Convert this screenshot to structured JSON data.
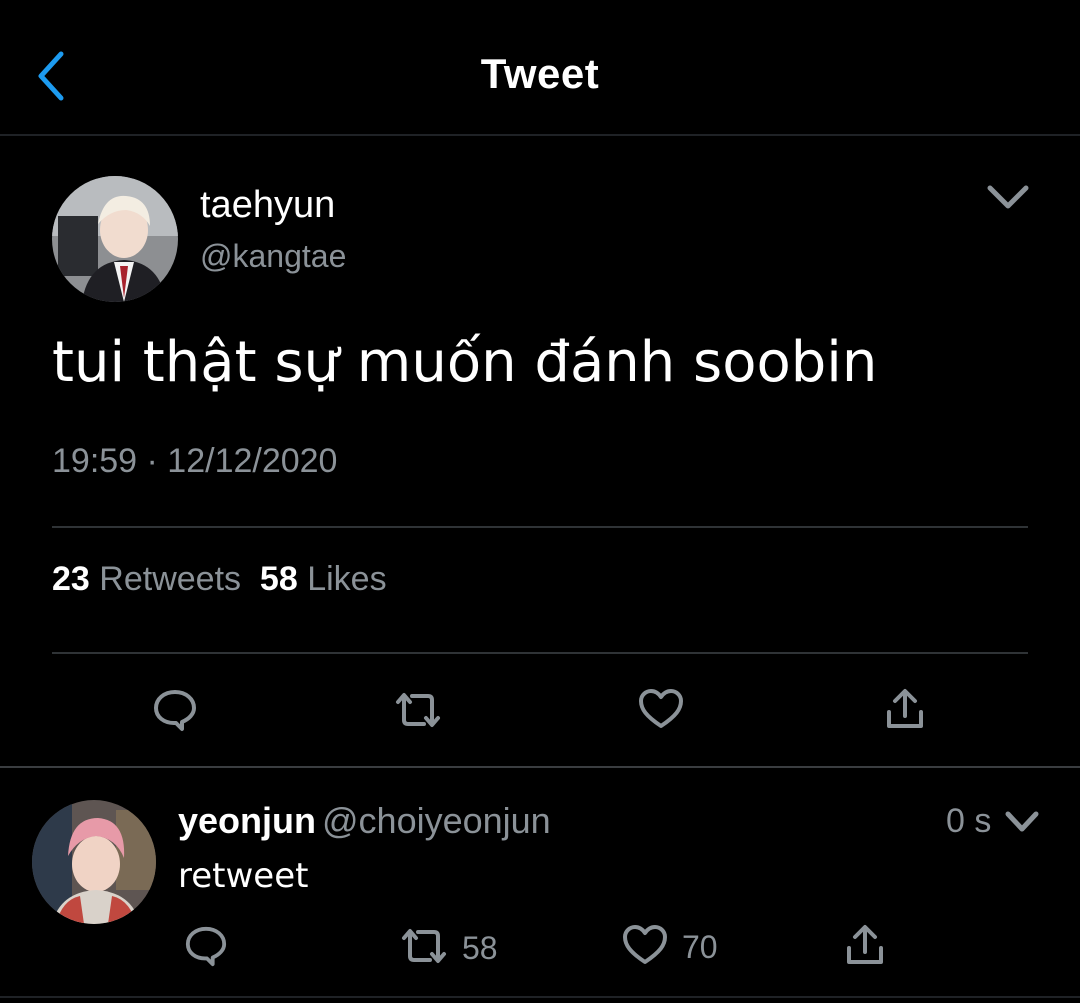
{
  "header": {
    "title": "Tweet",
    "back_icon": "chevron-left-icon"
  },
  "colors": {
    "accent": "#1d9bf0",
    "background": "#000000",
    "muted": "#8b9298",
    "divider": "#2f3336"
  },
  "tweet": {
    "author_name": "taehyun",
    "author_handle": "@kangtae",
    "text": "tui thật sự muốn đánh soobin",
    "timestamp": "19:59 · 12/12/2020",
    "retweet_count": "23",
    "retweet_label": "Retweets",
    "like_count": "58",
    "like_label": "Likes",
    "actions": [
      "reply-icon",
      "retweet-icon",
      "heart-icon",
      "share-icon"
    ]
  },
  "reply": {
    "author_name": "yeonjun",
    "author_handle": "@choiyeonjun",
    "time": "0 s",
    "text": "retweet",
    "retweet_count": "58",
    "like_count": "70",
    "actions": [
      "reply-icon",
      "retweet-icon",
      "heart-icon",
      "share-icon"
    ]
  }
}
